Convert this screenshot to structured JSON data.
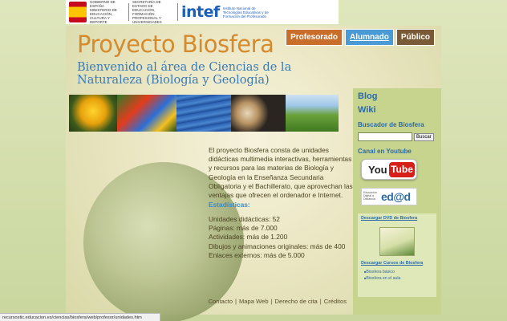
{
  "gov": {
    "ministry_text": "GOBIERNO DE ESPAÑA  MINISTERIO DE EDUCACIÓN, CULTURA Y DEPORTE",
    "secretaria_text": "SECRETARÍA DE ESTADO DE EDUCACIÓN, FORMACIÓN PROFESIONAL Y UNIVERSIDADES",
    "intef_logo": "intef",
    "intef_text": "Instituto Nacional de Tecnologías Educativas y de Formación del Profesorado"
  },
  "header": {
    "title": "Proyecto Biosfera",
    "subtitle": "Bienvenido al área de Ciencias de la Naturaleza (Biología y Geología)"
  },
  "topnav": {
    "profesorado": "Profesorado",
    "alumnado": "Alumnado",
    "publico": "Público"
  },
  "content": {
    "description": "El proyecto Biosfera consta de unidades didácticas multimedia interactivas, herramientas y recursos para las materias de Biología y Geología en la Enseñanza Secundaria Obligatoria y el Bachillerato, que aprovechan las ventajas que ofrecen el ordenador e Internet.",
    "stats_heading": "Estadísticas:",
    "stats": [
      "Unidades didácticas: 52",
      "Páginas: más de 7.000",
      "Actividades: más de 1.200",
      "Dibujos y animaciones originales: más de 400",
      "Enlaces externos: más de 5.000"
    ]
  },
  "footer": {
    "contacto": "Contacto",
    "mapa": "Mapa Web",
    "derecho": "Derecho de cita",
    "creditos": "Créditos",
    "sep": "|"
  },
  "sidebar": {
    "blog": "Blog",
    "wiki": "Wiki",
    "search_heading": "Buscador de Biosfera",
    "search_button": "Buscar",
    "youtube_heading": "Canal en Youtube",
    "youtube_you": "You",
    "youtube_tube": "Tube",
    "edad_small": "Educación Digital a Distancia",
    "edad_big": "ed@d",
    "dvd_title": "Descargar DVD de Biosfera",
    "cursos_title": "Descargar Cursos de Biosfera",
    "cursos": [
      "Biosfera básico",
      "Biosfera en el aula"
    ]
  },
  "status": {
    "url": "recursostic.educacion.es/ciencias/biosfera/web/profesor/unidades.htm"
  }
}
